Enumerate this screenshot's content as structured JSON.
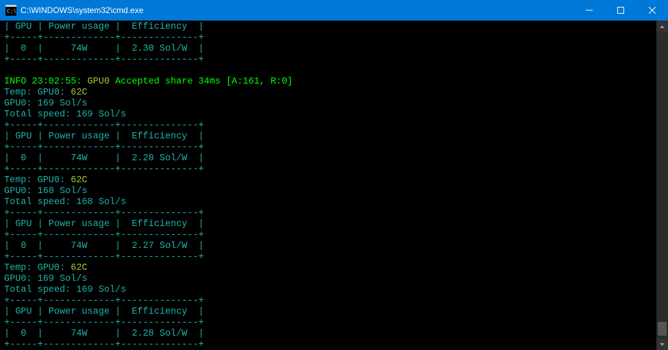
{
  "titlebar": {
    "title": "C:\\WINDOWS\\system32\\cmd.exe"
  },
  "term": {
    "hr": "+-----+-------------+--------------+",
    "hdr_gpu": "| GPU | Power usage |  Efficiency  |",
    "row_230": "|  0  |     74W     |  2.30 Sol/W  |",
    "row_228": "|  0  |     74W     |  2.28 Sol/W  |",
    "row_227": "|  0  |     74W     |  2.27 Sol/W  |",
    "info_prefix": "INFO 23:02:55: ",
    "info_gpu": "GPU0",
    "info_rest": " Accepted share 34ms [A:161, R:0]",
    "temp_label": "Temp: GPU0: ",
    "temp_val": "62C",
    "gpu169": "GPU0: 169 Sol/s",
    "gpu168": "GPU0: 168 Sol/s",
    "total169": "Total speed: 169 Sol/s",
    "total168": "Total speed: 168 Sol/s"
  }
}
